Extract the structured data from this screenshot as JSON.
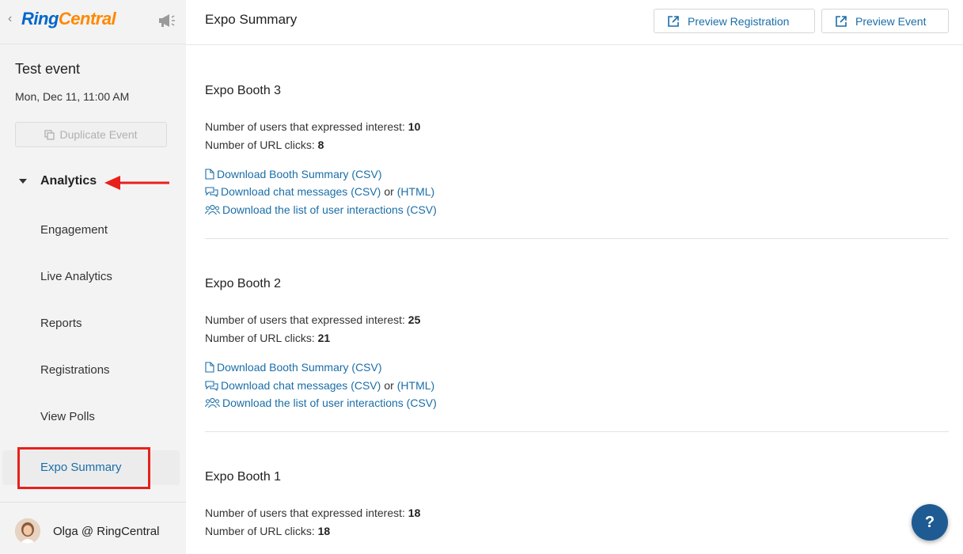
{
  "brand": {
    "ring": "Ring",
    "central": "Central"
  },
  "event": {
    "title": "Test event",
    "date": "Mon, Dec 11, 11:00 AM",
    "duplicate_label": "Duplicate Event"
  },
  "sidebar": {
    "analytics_label": "Analytics",
    "items": [
      {
        "label": "Engagement"
      },
      {
        "label": "Live Analytics"
      },
      {
        "label": "Reports"
      },
      {
        "label": "Registrations"
      },
      {
        "label": "View Polls"
      },
      {
        "label": "Expo Summary",
        "selected": true
      }
    ]
  },
  "user": {
    "name": "Olga @ RingCentral"
  },
  "header": {
    "title": "Expo Summary",
    "preview_registration": "Preview Registration",
    "preview_event": "Preview Event"
  },
  "labels": {
    "interest": "Number of users that expressed interest:",
    "url_clicks": "Number of URL clicks:",
    "download_summary": "Download Booth Summary (CSV)",
    "download_chat": "Download chat messages (CSV)",
    "or": "or",
    "html": "(HTML)",
    "download_interactions": "Download the list of user interactions (CSV)"
  },
  "booths": [
    {
      "name": "Expo Booth 3",
      "interest": "10",
      "url_clicks": "8"
    },
    {
      "name": "Expo Booth 2",
      "interest": "25",
      "url_clicks": "21"
    },
    {
      "name": "Expo Booth 1",
      "interest": "18",
      "url_clicks": "18"
    }
  ],
  "help": {
    "label": "?"
  },
  "colors": {
    "accent_link": "#1a6ea8",
    "brand_blue": "#0066cc",
    "brand_orange": "#ff8800",
    "annotation_red": "#e8201c",
    "help_button": "#1e5b93"
  }
}
